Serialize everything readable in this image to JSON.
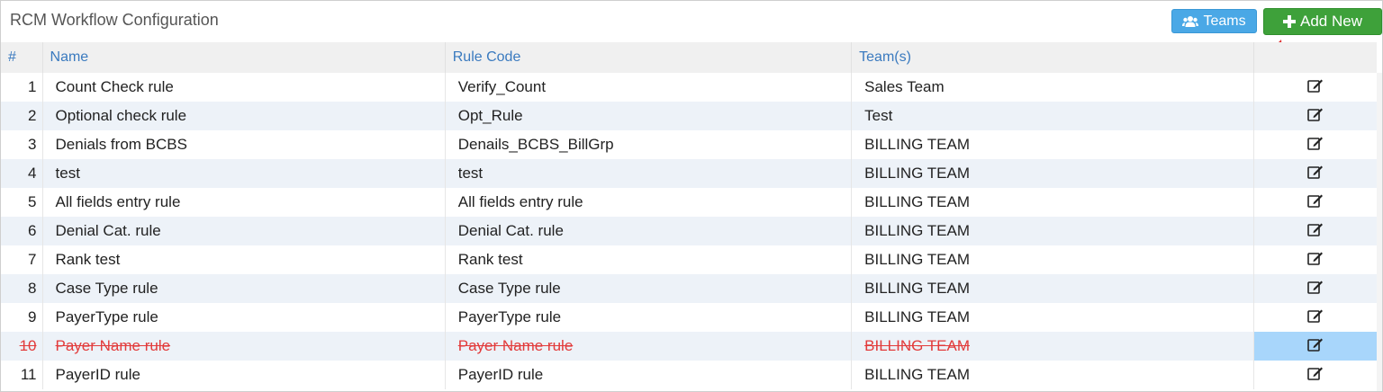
{
  "header": {
    "title": "RCM Workflow Configuration",
    "teams_label": "Teams",
    "add_new_label": "Add New"
  },
  "table": {
    "columns": [
      "#",
      "Name",
      "Rule Code",
      "Team(s)",
      ""
    ],
    "rows": [
      {
        "num": "1",
        "name": "Count Check rule",
        "code": "Verify_Count",
        "team": "Sales Team"
      },
      {
        "num": "2",
        "name": "Optional check rule",
        "code": "Opt_Rule",
        "team": "Test"
      },
      {
        "num": "3",
        "name": "Denials from BCBS",
        "code": "Denails_BCBS_BillGrp",
        "team": "BILLING TEAM"
      },
      {
        "num": "4",
        "name": "test",
        "code": "test",
        "team": "BILLING TEAM"
      },
      {
        "num": "5",
        "name": "All fields entry rule",
        "code": "All fields entry rule",
        "team": "BILLING TEAM"
      },
      {
        "num": "6",
        "name": "Denial Cat. rule",
        "code": "Denial Cat. rule",
        "team": "BILLING TEAM"
      },
      {
        "num": "7",
        "name": "Rank test",
        "code": "Rank test",
        "team": "BILLING TEAM"
      },
      {
        "num": "8",
        "name": "Case Type rule",
        "code": "Case Type rule",
        "team": "BILLING TEAM"
      },
      {
        "num": "9",
        "name": "PayerType rule",
        "code": "PayerType rule",
        "team": "BILLING TEAM"
      },
      {
        "num": "10",
        "name": "Payer Name rule",
        "code": "Payer Name rule",
        "team": "BILLING TEAM"
      },
      {
        "num": "11",
        "name": "PayerID rule",
        "code": "PayerID rule",
        "team": "BILLING TEAM"
      }
    ]
  },
  "colors": {
    "header_link": "#3a7abf",
    "teams_button": "#4aa8e6",
    "add_button": "#3ea13a",
    "struck_text": "#e23b3b",
    "selected_cell": "#a8d6fb"
  }
}
